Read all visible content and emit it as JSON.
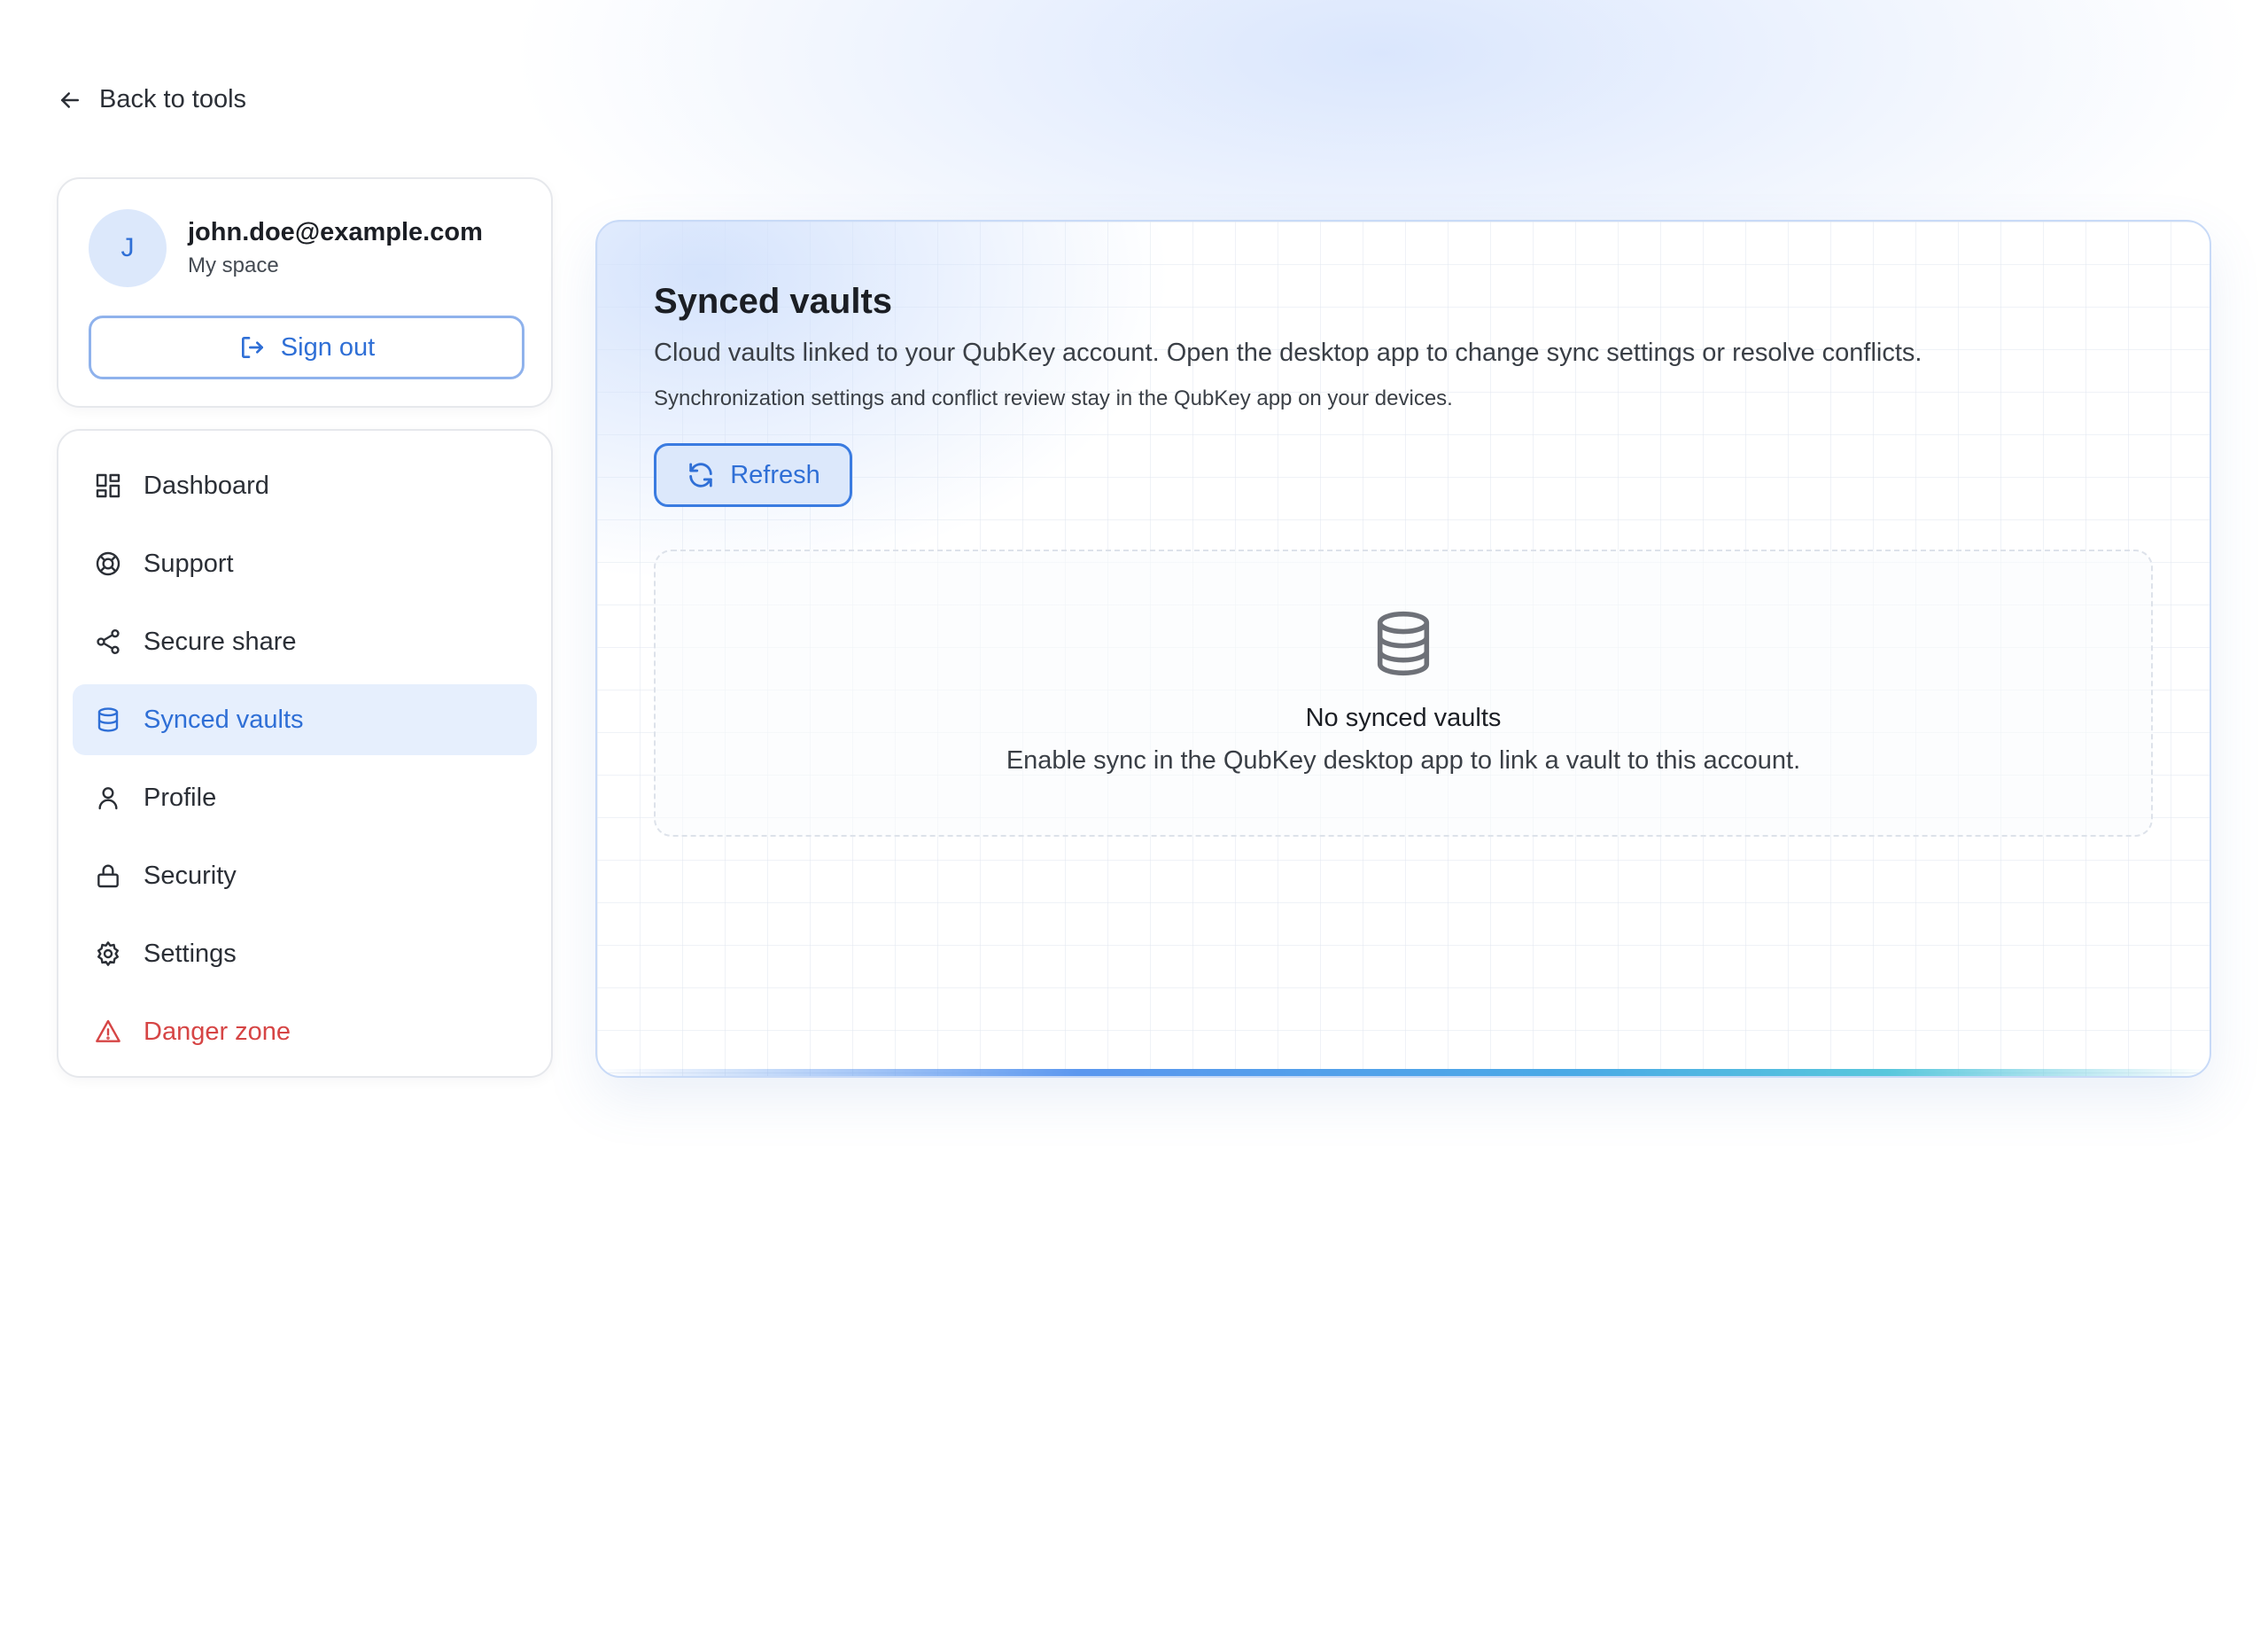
{
  "back_link": {
    "label": "Back to tools"
  },
  "account": {
    "avatar_initial": "J",
    "email": "john.doe@example.com",
    "space": "My space",
    "sign_out_label": "Sign out"
  },
  "nav": {
    "items": [
      {
        "label": "Dashboard",
        "icon": "dashboard-icon"
      },
      {
        "label": "Support",
        "icon": "lifebuoy-icon"
      },
      {
        "label": "Secure share",
        "icon": "share-icon"
      },
      {
        "label": "Synced vaults",
        "icon": "database-icon",
        "active": true
      },
      {
        "label": "Profile",
        "icon": "user-icon"
      },
      {
        "label": "Security",
        "icon": "lock-icon"
      },
      {
        "label": "Settings",
        "icon": "gear-icon"
      },
      {
        "label": "Danger zone",
        "icon": "warning-icon",
        "danger": true
      }
    ]
  },
  "main": {
    "title": "Synced vaults",
    "description": "Cloud vaults linked to your QubKey account. Open the desktop app to change sync settings or resolve conflicts.",
    "note": "Synchronization settings and conflict review stay in the QubKey app on your devices.",
    "refresh_label": "Refresh",
    "empty_state": {
      "icon": "database-icon",
      "title": "No synced vaults",
      "description": "Enable sync in the QubKey desktop app to link a vault to this account."
    }
  },
  "colors": {
    "accent": "#2f6fd6",
    "active_bg": "#e6effd",
    "danger": "#d64545"
  }
}
